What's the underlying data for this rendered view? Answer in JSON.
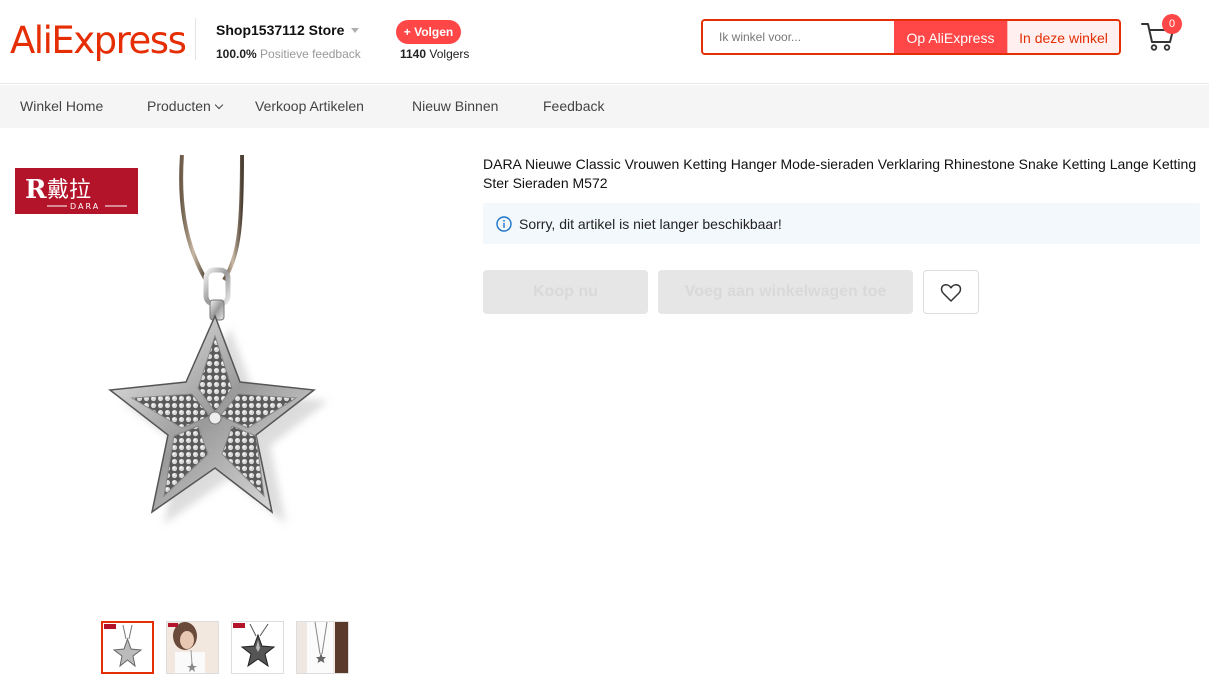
{
  "header": {
    "logo": "AliExpress",
    "store_name": "Shop1537112 Store",
    "feedback_percent": "100.0%",
    "feedback_label": "Positieve feedback",
    "follow_label": "+ Volgen",
    "followers_count": "1140",
    "followers_label": "Volgers",
    "search": {
      "placeholder": "Ik winkel voor...",
      "btn_aliexpress": "Op AliExpress",
      "btn_store": "In deze winkel"
    },
    "cart_count": "0"
  },
  "nav": {
    "items": [
      "Winkel Home",
      "Producten",
      "Verkoop Artikelen",
      "Nieuw Binnen",
      "Feedback"
    ]
  },
  "product": {
    "title": "DARA Nieuwe Classic Vrouwen Ketting Hanger Mode-sieraden Verklaring Rhinestone Snake Ketting Lange Ketting Ster Sieraden M572",
    "notice": "Sorry, dit artikel is niet langer beschikbaar!",
    "buy_now": "Koop nu",
    "add_to_cart": "Voeg aan winkelwagen toe",
    "brand_badge_chinese": "戴拉",
    "brand_badge_latin": "DARA",
    "thumbnails": [
      "star-pendant-silver",
      "model-wearing-necklace",
      "star-pendant-dark",
      "model-long-necklace"
    ]
  },
  "colors": {
    "brand_red": "#e62e04",
    "button_red": "#ff4747",
    "badge_maroon": "#b3142a",
    "notice_bg": "#f3f8fd",
    "disabled_bg": "#e6e6e6"
  }
}
